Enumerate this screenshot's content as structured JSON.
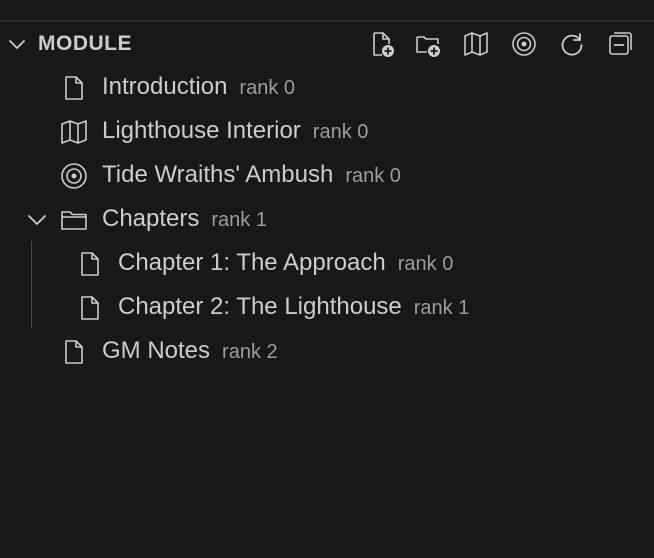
{
  "section": {
    "title": "MODULE",
    "actions": [
      {
        "name": "new-file-icon"
      },
      {
        "name": "new-folder-icon"
      },
      {
        "name": "map-icon"
      },
      {
        "name": "target-icon"
      },
      {
        "name": "refresh-icon"
      },
      {
        "name": "collapse-all-icon"
      }
    ]
  },
  "tree": {
    "items": [
      {
        "label": "Introduction",
        "rank": "rank 0",
        "icon": "file-icon"
      },
      {
        "label": "Lighthouse Interior",
        "rank": "rank 0",
        "icon": "map-icon"
      },
      {
        "label": "Tide Wraiths' Ambush",
        "rank": "rank 0",
        "icon": "target-icon"
      },
      {
        "label": "Chapters",
        "rank": "rank 1",
        "icon": "folder-icon",
        "expanded": true
      },
      {
        "label": "Chapter 1: The Approach",
        "rank": "rank 0",
        "icon": "file-icon"
      },
      {
        "label": "Chapter 2: The Lighthouse",
        "rank": "rank 1",
        "icon": "file-icon"
      },
      {
        "label": "GM Notes",
        "rank": "rank 2",
        "icon": "file-icon"
      }
    ]
  },
  "colors": {
    "background": "#181818",
    "text": "#cccccc",
    "description": "#9d9d9d"
  }
}
